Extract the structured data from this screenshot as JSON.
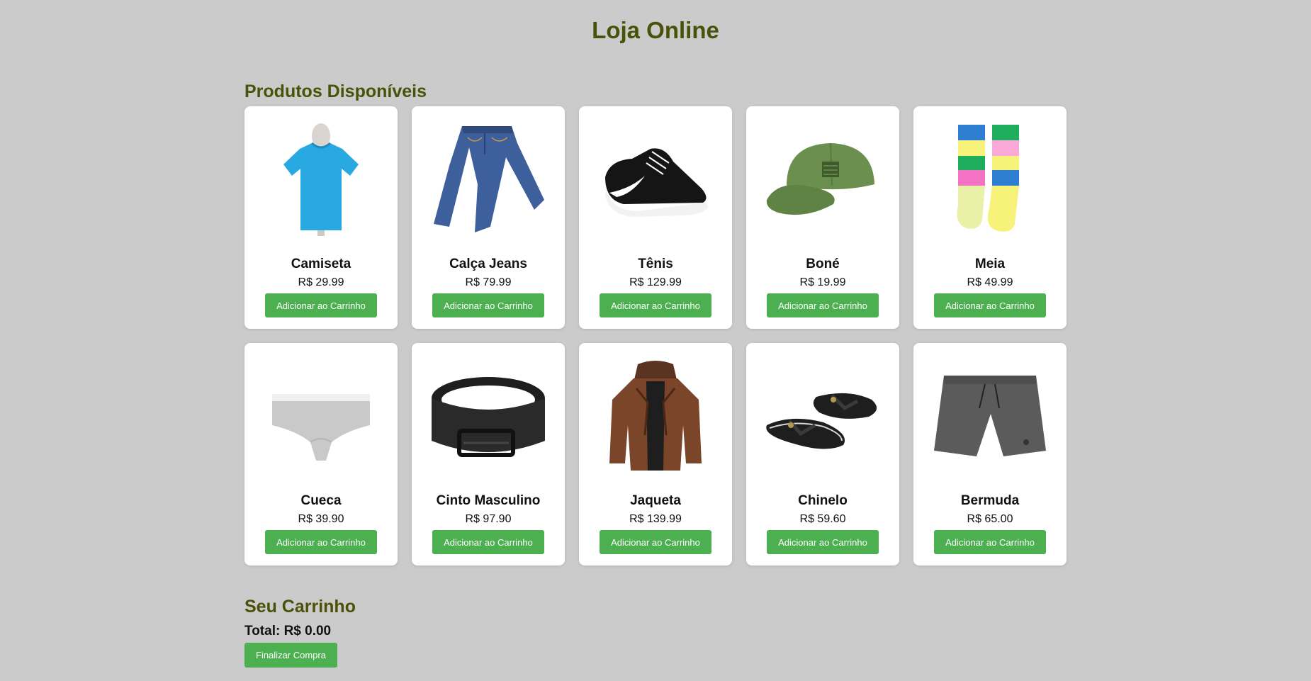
{
  "header": {
    "title": "Loja Online"
  },
  "products_section": {
    "title": "Produtos Disponíveis",
    "button_label": "Adicionar ao Carrinho",
    "items": [
      {
        "name": "Camiseta",
        "price": "R$ 29.99",
        "icon": "tshirt-icon"
      },
      {
        "name": "Calça Jeans",
        "price": "R$ 79.99",
        "icon": "jeans-icon"
      },
      {
        "name": "Tênis",
        "price": "R$ 129.99",
        "icon": "sneaker-icon"
      },
      {
        "name": "Boné",
        "price": "R$ 19.99",
        "icon": "cap-icon"
      },
      {
        "name": "Meia",
        "price": "R$ 49.99",
        "icon": "socks-icon"
      },
      {
        "name": "Cueca",
        "price": "R$ 39.90",
        "icon": "underwear-icon"
      },
      {
        "name": "Cinto Masculino",
        "price": "R$ 97.90",
        "icon": "belt-icon"
      },
      {
        "name": "Jaqueta",
        "price": "R$ 139.99",
        "icon": "jacket-icon"
      },
      {
        "name": "Chinelo",
        "price": "R$ 59.60",
        "icon": "flip-flops-icon"
      },
      {
        "name": "Bermuda",
        "price": "R$ 65.00",
        "icon": "shorts-icon"
      }
    ]
  },
  "cart": {
    "title": "Seu Carrinho",
    "total": "Total: R$ 0.00",
    "checkout_label": "Finalizar Compra"
  },
  "colors": {
    "background": "#cbcbcb",
    "heading": "#4a5209",
    "button": "#4caf50",
    "card": "#ffffff"
  }
}
